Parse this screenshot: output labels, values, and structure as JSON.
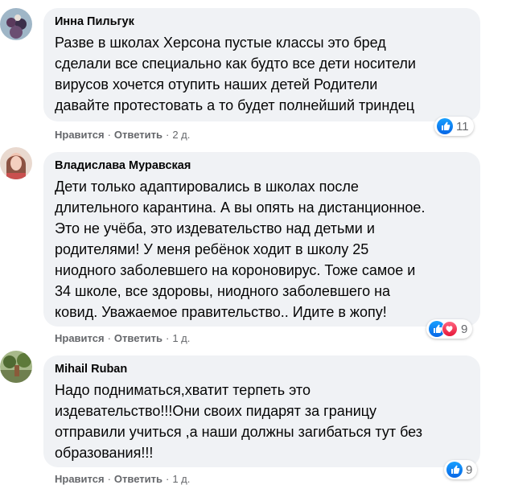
{
  "comments": [
    {
      "author": "Инна Пильгук",
      "text": "Разве в школах Херсона пустые классы это бред\nсделали все специально как будто все дети носители\nвирусов хочется отупить наших детей Родители\nдавайте протестовать а то будет полнейший триндец",
      "like_label": "Нравится",
      "reply_label": "Ответить",
      "time": "2 д.",
      "reaction_count": "11",
      "reactions": [
        "like-icon"
      ]
    },
    {
      "author": "Владислава Муравская",
      "text": "Дети только адаптировались в школах после\nдлительного карантина. А вы опять на дистанционное.\nЭто не учёба, это издевательство над детьми и\nродителями! У меня ребёнок ходит в школу 25\nниодного заболевшего на короновирус. Тоже самое и\n34 школе, все здоровы, ниодного заболевшего на\nковид. Уважаемое правительство.. Идите в жопу!",
      "like_label": "Нравится",
      "reply_label": "Ответить",
      "time": "1 д.",
      "reaction_count": "9",
      "reactions": [
        "like-icon",
        "love-icon"
      ]
    },
    {
      "author": "Mihail Ruban",
      "text": "Надо подниматься,хватит терпеть это\nиздевательство!!!Они своих пидарят за границу\nотправили учиться ,а наши должны загибаться тут без\nобразования!!!",
      "like_label": "Нравится",
      "reply_label": "Ответить",
      "time": "1 д.",
      "reaction_count": "9",
      "reactions": [
        "like-icon"
      ]
    }
  ],
  "separator": "·",
  "colors": {
    "bubble": "#f0f2f5",
    "meta": "#65676b",
    "like": "#1877f2",
    "love": "#f33e58"
  }
}
